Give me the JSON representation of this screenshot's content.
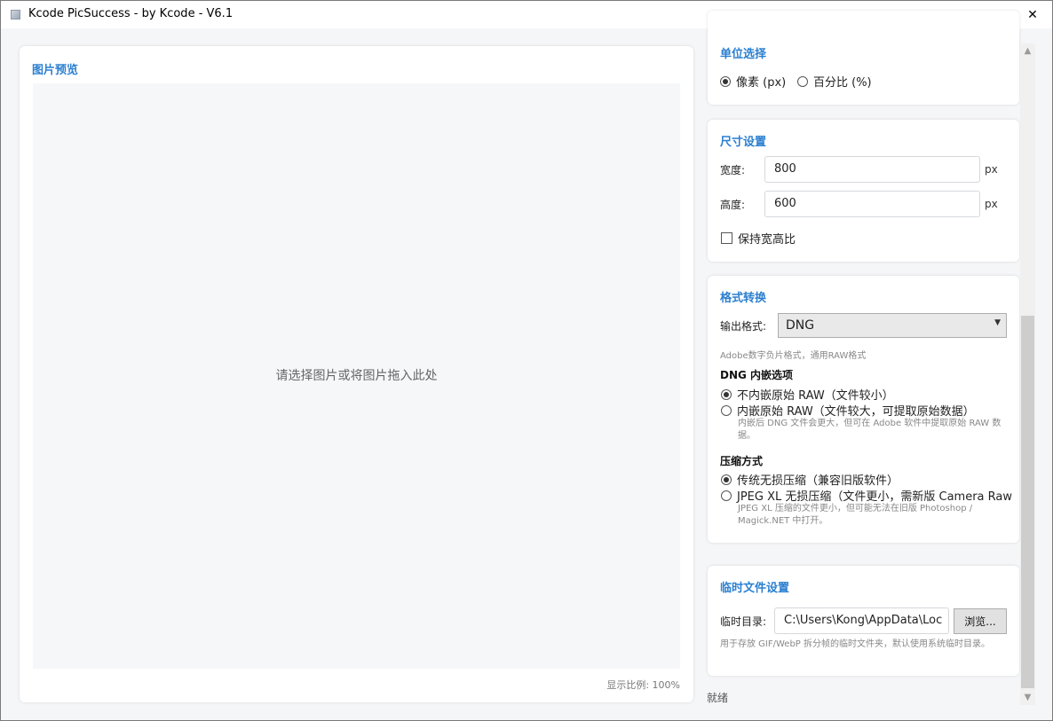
{
  "window": {
    "title": "Kcode PicSuccess - by Kcode - V6.1"
  },
  "preview": {
    "title": "图片预览",
    "hint": "请选择图片或将图片拖入此处",
    "zoom": "显示比例: 100%"
  },
  "unit": {
    "title": "单位选择",
    "options": [
      "像素 (px)",
      "百分比 (%)"
    ],
    "selected": "像素 (px)"
  },
  "size": {
    "title": "尺寸设置",
    "width_label": "宽度:",
    "width_value": "800",
    "height_label": "高度:",
    "height_value": "600",
    "unit_suffix": "px",
    "keep_ratio_label": "保持宽高比",
    "keep_ratio_checked": false
  },
  "format": {
    "title": "格式转换",
    "output_label": "输出格式:",
    "output_value": "DNG",
    "description": "Adobe数字负片格式，通用RAW格式",
    "embed_heading": "DNG 内嵌选项",
    "embed_options": [
      "不内嵌原始 RAW（文件较小）",
      "内嵌原始 RAW（文件较大，可提取原始数据）"
    ],
    "embed_selected": 0,
    "embed_note": "内嵌后 DNG 文件会更大，但可在 Adobe 软件中提取原始 RAW 数据。",
    "compress_heading": "压缩方式",
    "compress_options": [
      "传统无损压缩（兼容旧版软件）",
      "JPEG XL 无损压缩（文件更小，需新版 Camera Raw"
    ],
    "compress_selected": 0,
    "compress_note": "JPEG XL 压缩的文件更小，但可能无法在旧版 Photoshop / Magick.NET 中打开。"
  },
  "temp": {
    "title": "临时文件设置",
    "dir_label": "临时目录:",
    "dir_value": "C:\\Users\\Kong\\AppData\\Loc",
    "browse_label": "浏览...",
    "note": "用于存放 GIF/WebP 拆分帧的临时文件夹，默认使用系统临时目录。"
  },
  "status": "就绪"
}
